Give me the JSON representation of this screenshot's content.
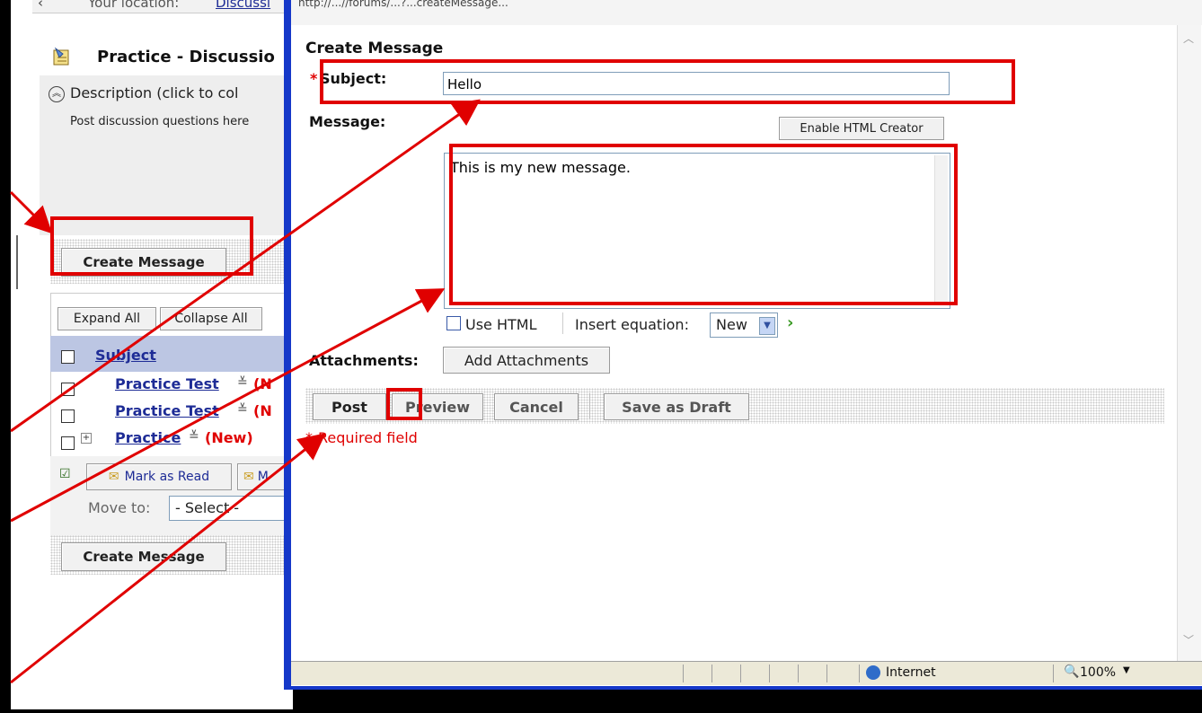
{
  "background_page": {
    "location_label": "Your location:",
    "location_link": "Discussi",
    "page_title": "Practice - Discussio",
    "description_toggle": "Description (click to col",
    "description_text": "Post discussion questions here",
    "create_message_top": "Create Message",
    "expand_all": "Expand All",
    "collapse_all": "Collapse All",
    "subject_header": "Subject",
    "threads": [
      {
        "title": "Practice Test",
        "badge": "(N"
      },
      {
        "title": "Practice Test",
        "badge": "(N"
      },
      {
        "title": "Practice",
        "badge": "(New)"
      }
    ],
    "mark_as_read": "Mark as Read",
    "mark_short": "M",
    "move_to_label": "Move to:",
    "move_to_value": "- Select -",
    "create_message_bottom": "Create Message"
  },
  "popup": {
    "url_text": "http://...//forums/...?...createMessage...",
    "heading": "Create Message",
    "required_star": "*",
    "subject_label": "Subject:",
    "subject_value": "Hello",
    "message_label": "Message:",
    "enable_html_creator": "Enable HTML Creator",
    "message_text": "This is my new message.",
    "use_html_label": "Use HTML",
    "insert_equation_label": "Insert equation:",
    "equation_value": "New",
    "attachments_label": "Attachments:",
    "add_attachments": "Add Attachments",
    "post": "Post",
    "preview": "Preview",
    "cancel": "Cancel",
    "save_as_draft": "Save as Draft",
    "required_note": "Required field",
    "status_zone": "Internet",
    "zoom": "100%"
  },
  "colors": {
    "annotation_red": "#e00000",
    "window_border": "#1538c9",
    "link_blue": "#1e2c96"
  }
}
